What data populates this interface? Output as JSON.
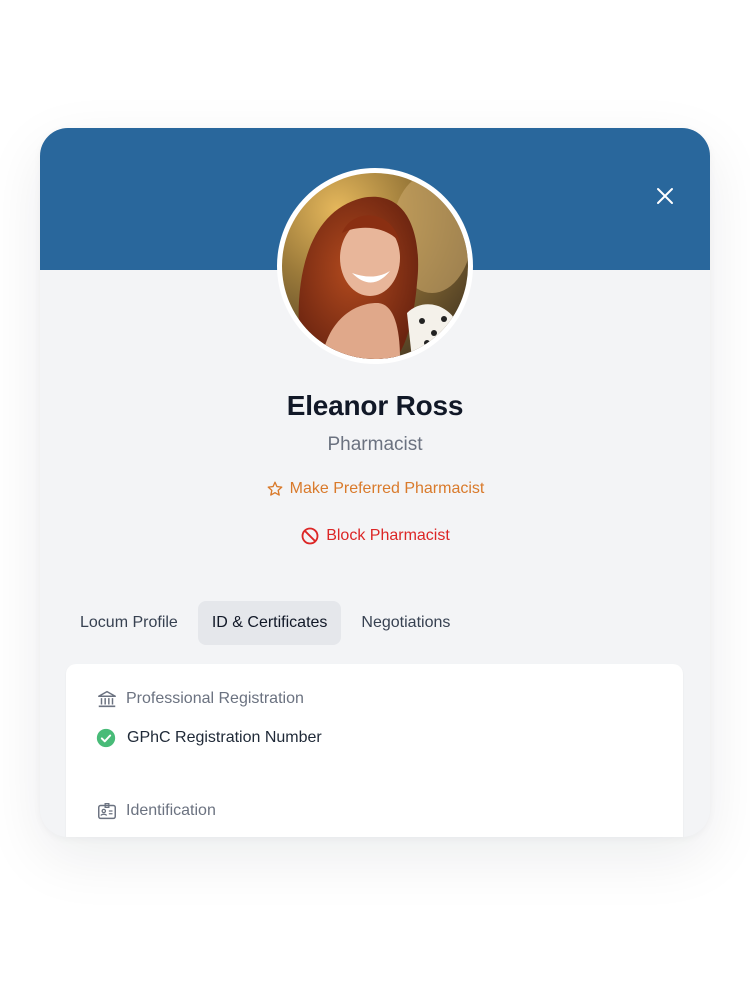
{
  "profile": {
    "name": "Eleanor Ross",
    "role": "Pharmacist",
    "avatar_description": "portrait photo of smiling woman with curly auburn hair"
  },
  "actions": {
    "prefer_label": "Make Preferred Pharmacist",
    "block_label": "Block Pharmacist"
  },
  "tabs": [
    {
      "label": "Locum Profile",
      "active": false
    },
    {
      "label": "ID & Certificates",
      "active": true
    },
    {
      "label": "Negotiations",
      "active": false
    }
  ],
  "sections": {
    "registration": {
      "title": "Professional Registration",
      "items": [
        {
          "label": "GPhC Registration Number",
          "status": "verified"
        }
      ]
    },
    "identification": {
      "title": "Identification"
    }
  },
  "colors": {
    "header": "#29679c",
    "prefer": "#d97a2b",
    "block": "#dc2626",
    "verified": "#48bb78"
  },
  "icons": {
    "close": "close-icon",
    "prefer": "star-icon",
    "block": "ban-icon",
    "registration": "bank-icon",
    "identification": "id-card-icon",
    "verified": "check-circle-icon"
  }
}
